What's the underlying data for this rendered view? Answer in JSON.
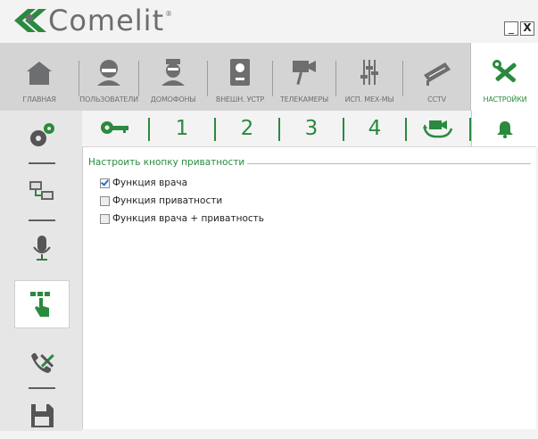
{
  "app": {
    "logo_text": "Comelit",
    "logo_reg": "®"
  },
  "window": {
    "minimize_label": "_",
    "close_label": "X"
  },
  "top_tabs": [
    {
      "label": "ГЛАВНАЯ",
      "icon": "home-icon",
      "active": false
    },
    {
      "label": "ПОЛЬЗОВАТЕЛИ",
      "icon": "user-icon",
      "active": false
    },
    {
      "label": "ДОМОФОНЫ",
      "icon": "concierge-icon",
      "active": false
    },
    {
      "label": "ВНЕШН. УСТР",
      "icon": "outdoor-station-icon",
      "active": false
    },
    {
      "label": "ТЕЛЕКАМЕРЫ",
      "icon": "camera-icon",
      "active": false
    },
    {
      "label": "ИСП. МЕХ-МЫ",
      "icon": "actuators-icon",
      "active": false
    },
    {
      "label": "CCTV",
      "icon": "cctv-icon",
      "active": false
    },
    {
      "label": "НАСТРОЙКИ",
      "icon": "tools-icon",
      "active": true
    }
  ],
  "sub_tabs": [
    {
      "label": "",
      "icon": "key-icon",
      "active": false
    },
    {
      "label": "1",
      "active": false
    },
    {
      "label": "2",
      "active": false
    },
    {
      "label": "3",
      "active": false
    },
    {
      "label": "4",
      "active": false
    },
    {
      "label": "",
      "icon": "camera-switch-icon",
      "active": false
    },
    {
      "label": "",
      "icon": "bell-icon",
      "active": true
    }
  ],
  "sidebar": [
    {
      "icon": "gears-icon",
      "active": false
    },
    {
      "icon": "network-icon",
      "active": false
    },
    {
      "icon": "microphone-icon",
      "active": false
    },
    {
      "icon": "touch-keypad-icon",
      "active": true
    },
    {
      "icon": "phone-tools-icon",
      "active": false
    },
    {
      "icon": "save-icon",
      "active": false
    }
  ],
  "privacy_group": {
    "title": "Настроить кнопку приватности",
    "options": [
      {
        "label": "Функция врача",
        "checked": true
      },
      {
        "label": "Функция приватности",
        "checked": false
      },
      {
        "label": "Функция врача + приватность",
        "checked": false
      }
    ]
  },
  "colors": {
    "accent": "#2a8a3e",
    "gray_icon": "#6d6e70",
    "nav_bg": "#d4d4d4"
  }
}
